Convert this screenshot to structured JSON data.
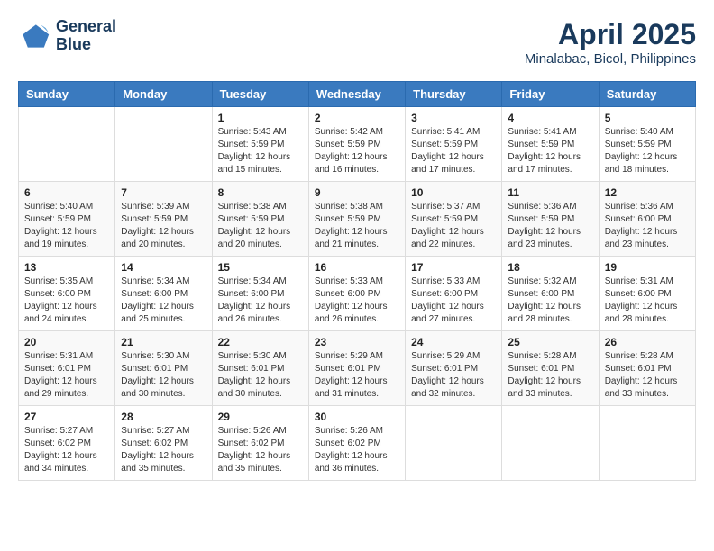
{
  "logo": {
    "line1": "General",
    "line2": "Blue"
  },
  "header": {
    "month": "April 2025",
    "location": "Minalabac, Bicol, Philippines"
  },
  "weekdays": [
    "Sunday",
    "Monday",
    "Tuesday",
    "Wednesday",
    "Thursday",
    "Friday",
    "Saturday"
  ],
  "weeks": [
    [
      null,
      null,
      {
        "day": 1,
        "sunrise": "5:43 AM",
        "sunset": "5:59 PM",
        "daylight": "12 hours and 15 minutes."
      },
      {
        "day": 2,
        "sunrise": "5:42 AM",
        "sunset": "5:59 PM",
        "daylight": "12 hours and 16 minutes."
      },
      {
        "day": 3,
        "sunrise": "5:41 AM",
        "sunset": "5:59 PM",
        "daylight": "12 hours and 17 minutes."
      },
      {
        "day": 4,
        "sunrise": "5:41 AM",
        "sunset": "5:59 PM",
        "daylight": "12 hours and 17 minutes."
      },
      {
        "day": 5,
        "sunrise": "5:40 AM",
        "sunset": "5:59 PM",
        "daylight": "12 hours and 18 minutes."
      }
    ],
    [
      {
        "day": 6,
        "sunrise": "5:40 AM",
        "sunset": "5:59 PM",
        "daylight": "12 hours and 19 minutes."
      },
      {
        "day": 7,
        "sunrise": "5:39 AM",
        "sunset": "5:59 PM",
        "daylight": "12 hours and 20 minutes."
      },
      {
        "day": 8,
        "sunrise": "5:38 AM",
        "sunset": "5:59 PM",
        "daylight": "12 hours and 20 minutes."
      },
      {
        "day": 9,
        "sunrise": "5:38 AM",
        "sunset": "5:59 PM",
        "daylight": "12 hours and 21 minutes."
      },
      {
        "day": 10,
        "sunrise": "5:37 AM",
        "sunset": "5:59 PM",
        "daylight": "12 hours and 22 minutes."
      },
      {
        "day": 11,
        "sunrise": "5:36 AM",
        "sunset": "5:59 PM",
        "daylight": "12 hours and 23 minutes."
      },
      {
        "day": 12,
        "sunrise": "5:36 AM",
        "sunset": "6:00 PM",
        "daylight": "12 hours and 23 minutes."
      }
    ],
    [
      {
        "day": 13,
        "sunrise": "5:35 AM",
        "sunset": "6:00 PM",
        "daylight": "12 hours and 24 minutes."
      },
      {
        "day": 14,
        "sunrise": "5:34 AM",
        "sunset": "6:00 PM",
        "daylight": "12 hours and 25 minutes."
      },
      {
        "day": 15,
        "sunrise": "5:34 AM",
        "sunset": "6:00 PM",
        "daylight": "12 hours and 26 minutes."
      },
      {
        "day": 16,
        "sunrise": "5:33 AM",
        "sunset": "6:00 PM",
        "daylight": "12 hours and 26 minutes."
      },
      {
        "day": 17,
        "sunrise": "5:33 AM",
        "sunset": "6:00 PM",
        "daylight": "12 hours and 27 minutes."
      },
      {
        "day": 18,
        "sunrise": "5:32 AM",
        "sunset": "6:00 PM",
        "daylight": "12 hours and 28 minutes."
      },
      {
        "day": 19,
        "sunrise": "5:31 AM",
        "sunset": "6:00 PM",
        "daylight": "12 hours and 28 minutes."
      }
    ],
    [
      {
        "day": 20,
        "sunrise": "5:31 AM",
        "sunset": "6:01 PM",
        "daylight": "12 hours and 29 minutes."
      },
      {
        "day": 21,
        "sunrise": "5:30 AM",
        "sunset": "6:01 PM",
        "daylight": "12 hours and 30 minutes."
      },
      {
        "day": 22,
        "sunrise": "5:30 AM",
        "sunset": "6:01 PM",
        "daylight": "12 hours and 30 minutes."
      },
      {
        "day": 23,
        "sunrise": "5:29 AM",
        "sunset": "6:01 PM",
        "daylight": "12 hours and 31 minutes."
      },
      {
        "day": 24,
        "sunrise": "5:29 AM",
        "sunset": "6:01 PM",
        "daylight": "12 hours and 32 minutes."
      },
      {
        "day": 25,
        "sunrise": "5:28 AM",
        "sunset": "6:01 PM",
        "daylight": "12 hours and 33 minutes."
      },
      {
        "day": 26,
        "sunrise": "5:28 AM",
        "sunset": "6:01 PM",
        "daylight": "12 hours and 33 minutes."
      }
    ],
    [
      {
        "day": 27,
        "sunrise": "5:27 AM",
        "sunset": "6:02 PM",
        "daylight": "12 hours and 34 minutes."
      },
      {
        "day": 28,
        "sunrise": "5:27 AM",
        "sunset": "6:02 PM",
        "daylight": "12 hours and 35 minutes."
      },
      {
        "day": 29,
        "sunrise": "5:26 AM",
        "sunset": "6:02 PM",
        "daylight": "12 hours and 35 minutes."
      },
      {
        "day": 30,
        "sunrise": "5:26 AM",
        "sunset": "6:02 PM",
        "daylight": "12 hours and 36 minutes."
      },
      null,
      null,
      null
    ]
  ]
}
